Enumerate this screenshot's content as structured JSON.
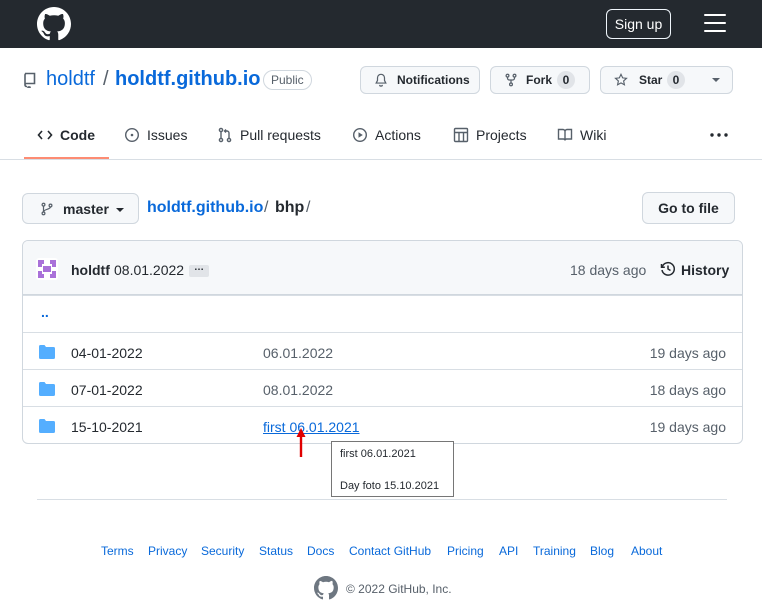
{
  "header": {
    "signup_label": "Sign up"
  },
  "repo": {
    "owner": "holdtf",
    "name": "holdtf.github.io",
    "visibility": "Public",
    "notifications_label": "Notifications",
    "fork_label": "Fork",
    "fork_count": "0",
    "star_label": "Star",
    "star_count": "0"
  },
  "tabs": [
    {
      "label": "Code",
      "icon": "code-icon",
      "active": true
    },
    {
      "label": "Issues",
      "icon": "issue-icon"
    },
    {
      "label": "Pull requests",
      "icon": "pull-request-icon"
    },
    {
      "label": "Actions",
      "icon": "play-icon"
    },
    {
      "label": "Projects",
      "icon": "table-icon"
    },
    {
      "label": "Wiki",
      "icon": "book-icon"
    }
  ],
  "breadcrumb": {
    "branch": "master",
    "repo": "holdtf.github.io",
    "sep": "/",
    "dir": "bhp",
    "trail": "/",
    "goto_file": "Go to file"
  },
  "commit": {
    "author": "holdtf",
    "message": "08.01.2022",
    "ellipsis": "…",
    "age": "18 days ago",
    "history_label": "History"
  },
  "parent_dir": "..",
  "files": [
    {
      "name": "04-01-2022",
      "message": "06.01.2022",
      "age": "19 days ago"
    },
    {
      "name": "07-01-2022",
      "message": "08.01.2022",
      "age": "18 days ago"
    },
    {
      "name": "15-10-2021",
      "message": "first 06.01.2021",
      "age": "19 days ago",
      "hovered": true
    }
  ],
  "tooltip": {
    "line1": "first 06.01.2021",
    "line2": "Day foto 15.10.2021"
  },
  "footer": {
    "links": [
      "Terms",
      "Privacy",
      "Security",
      "Status",
      "Docs",
      "Contact GitHub",
      "Pricing",
      "API",
      "Training",
      "Blog",
      "About"
    ],
    "copyright": "© 2022 GitHub, Inc."
  },
  "colors": {
    "header_bg": "#24292f",
    "link": "#0969da",
    "folder": "#54aeff",
    "tab_underline": "#fd8c73",
    "annotation_arrow": "#e00000"
  }
}
